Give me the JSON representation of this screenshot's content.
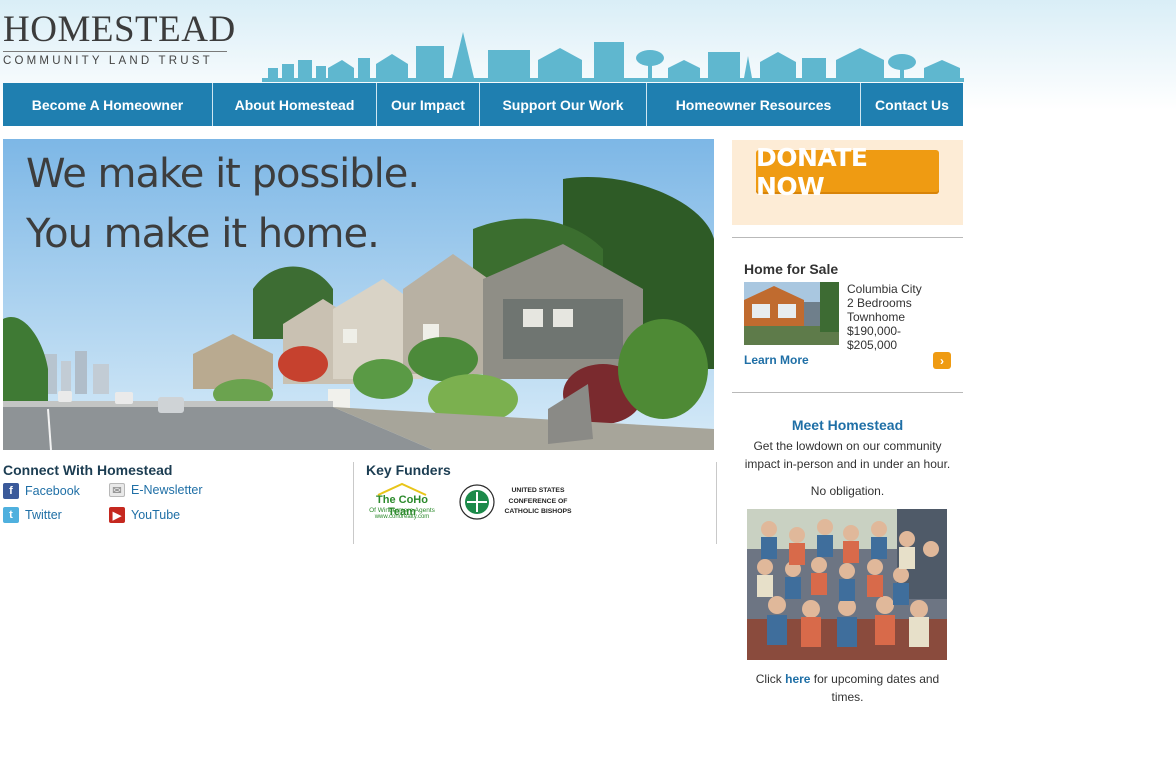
{
  "logo": {
    "main": "HOMESTEAD",
    "sub": "COMMUNITY LAND TRUST"
  },
  "nav": {
    "items": [
      {
        "label": "Become A Homeowner"
      },
      {
        "label": "About Homestead"
      },
      {
        "label": "Our Impact"
      },
      {
        "label": "Support Our Work"
      },
      {
        "label": "Homeowner Resources"
      },
      {
        "label": "Contact Us"
      }
    ]
  },
  "hero": {
    "line1": "We make it possible.",
    "line2": "You make it home."
  },
  "connect": {
    "title": "Connect With Homestead",
    "facebook": "Facebook",
    "enewsletter": "E-Newsletter",
    "twitter": "Twitter",
    "youtube": "YouTube"
  },
  "funders": {
    "title": "Key Funders",
    "coho_name": "The CoHo Team",
    "coho_sub": "Of Windermere Agents",
    "coho_url": "www.cohorealty.com",
    "usccb_line1": "UNITED STATES",
    "usccb_line2": "CONFERENCE OF",
    "usccb_line3": "CATHOLIC BISHOPS"
  },
  "donate": {
    "label": "DONATE NOW"
  },
  "home_for_sale": {
    "title": "Home for Sale",
    "lines": [
      "Columbia City",
      "2 Bedrooms",
      "Townhome",
      "$190,000-",
      "$205,000"
    ],
    "learn_more": "Learn More",
    "chevron": "›"
  },
  "meet": {
    "title": "Meet Homestead",
    "text": "Get the lowdown on our community impact in-person and in under an hour.",
    "obligation": "No obligation.",
    "click_prefix": "Click ",
    "click_link": "here",
    "click_suffix": " for upcoming dates and times."
  },
  "colors": {
    "nav_blue": "#1f7fb0",
    "donate_orange": "#ef9b12",
    "link_blue": "#1f6fa6",
    "skyline": "#5fb7cf"
  },
  "icons": {
    "facebook": "facebook-icon",
    "email": "envelope-icon",
    "twitter": "twitter-icon",
    "youtube": "youtube-icon"
  }
}
